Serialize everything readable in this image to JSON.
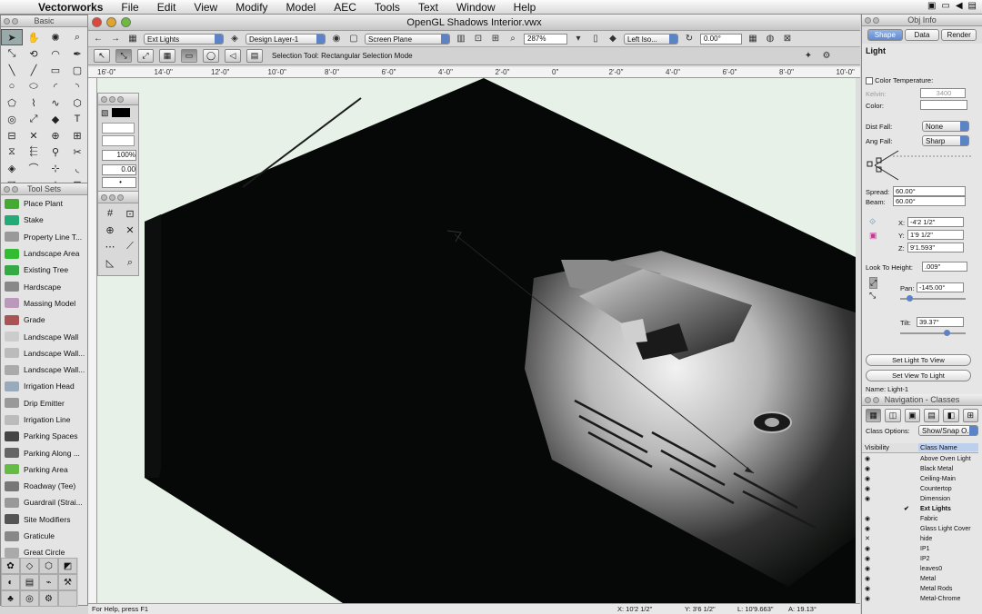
{
  "menubar": {
    "app": "Vectorworks",
    "items": [
      "File",
      "Edit",
      "View",
      "Modify",
      "Model",
      "AEC",
      "Tools",
      "Text",
      "Window",
      "Help"
    ]
  },
  "basic_palette": {
    "title": "Basic",
    "tools": [
      "arrow",
      "pan",
      "flyover",
      "zoom",
      "2d-reshape",
      "rotate",
      "walkthrough",
      "eyedropper",
      "line",
      "text-cursor",
      "rectangle",
      "rounded-rect",
      "circle",
      "oval",
      "arc",
      "quarter-arc",
      "polygon",
      "polyline",
      "freehand",
      "double-line",
      "spiral",
      "regular-polygon",
      "double-polygon",
      "text-T",
      "paragraph",
      "helix",
      "move-camera",
      "section",
      "mirror",
      "offset",
      "wand",
      "clip",
      "symbol",
      "trim",
      "grid-line",
      "fillet",
      "chamfer",
      "connect",
      "split",
      "attribute-map"
    ]
  },
  "toolsets": {
    "title": "Tool Sets",
    "items": [
      "Place Plant",
      "Stake",
      "Property Line T...",
      "Landscape Area",
      "Existing Tree",
      "Hardscape",
      "Massing Model",
      "Grade",
      "Landscape Wall",
      "Landscape Wall...",
      "Landscape Wall...",
      "Irrigation Head",
      "Drip Emitter",
      "Irrigation Line",
      "Parking Spaces",
      "Parking Along ...",
      "Parking Area",
      "Roadway (Tee)",
      "Guardrail (Strai...",
      "Site Modifiers",
      "Graticule",
      "Great Circle"
    ]
  },
  "document": {
    "title": "OpenGL Shadows Interior.vwx",
    "class_popup": "Ext Lights",
    "layer_popup": "Design Layer-1",
    "plane_popup": "Screen Plane",
    "zoom": "287%",
    "view_popup": "Left Iso...",
    "rotation": "0.00°",
    "mode_hint": "Selection Tool: Rectangular Selection Mode"
  },
  "ruler": {
    "labels": [
      "16'-0\"",
      "14'-0\"",
      "12'-0\"",
      "10'-0\"",
      "8'-0\"",
      "6'-0\"",
      "4'-0\"",
      "2'-0\"",
      "0\"",
      "2'-0\"",
      "4'-0\"",
      "6'-0\"",
      "8'-0\"",
      "10'-0\""
    ]
  },
  "attributes": {
    "zoom": "100%",
    "line_weight": "0.00"
  },
  "status": {
    "help": "For Help, press F1",
    "x": "X: 10'2 1/2\"",
    "y": "Y: 3'6 1/2\"",
    "l": "L: 10'9.663\"",
    "a": "A: 19.13°"
  },
  "obj_info": {
    "title": "Obj Info",
    "tabs": [
      "Shape",
      "Data",
      "Render"
    ],
    "object": "Light",
    "color_temp_label": "Color Temperature:",
    "kelvin_label": "Kelvin:",
    "kelvin": "3400",
    "color_label": "Color:",
    "dist_fall_label": "Dist Fall:",
    "dist_fall": "None",
    "ang_fall_label": "Ang Fall:",
    "ang_fall": "Sharp",
    "spread_label": "Spread:",
    "spread": "60.00°",
    "beam_label": "Beam:",
    "beam": "60.00°",
    "x_label": "X:",
    "x": "-4'2 1/2\"",
    "y_label": "Y:",
    "y": "1'9 1/2\"",
    "z_label": "Z:",
    "z": "9'1.593\"",
    "look_label": "Look To Height:",
    "look": ".009\"",
    "pan_label": "Pan:",
    "pan": "-145.00°",
    "tilt_label": "Tilt:",
    "tilt": "39.37°",
    "btn_light_to_view": "Set Light To View",
    "btn_view_to_light": "Set View To Light",
    "name": "Name: Light-1"
  },
  "navigation": {
    "title": "Navigation - Classes",
    "options_label": "Class Options:",
    "options": "Show/Snap O...",
    "col_visibility": "Visibility",
    "col_name": "Class Name",
    "classes": [
      {
        "eye": "◉",
        "name": "Above Oven Light"
      },
      {
        "eye": "◉",
        "name": "Black Metal"
      },
      {
        "eye": "◉",
        "name": "Ceiling-Main"
      },
      {
        "eye": "◉",
        "name": "Countertop"
      },
      {
        "eye": "◉",
        "name": "Dimension"
      },
      {
        "eye": "✔",
        "name": "Ext Lights"
      },
      {
        "eye": "◉",
        "name": "Fabric"
      },
      {
        "eye": "◉",
        "name": "Glass Light Cover"
      },
      {
        "eye": "✕",
        "name": "hide"
      },
      {
        "eye": "◉",
        "name": "IP1"
      },
      {
        "eye": "◉",
        "name": "IP2"
      },
      {
        "eye": "◉",
        "name": "leaves0"
      },
      {
        "eye": "◉",
        "name": "Metal"
      },
      {
        "eye": "◉",
        "name": "Metal Rods"
      },
      {
        "eye": "◉",
        "name": "Metal-Chrome"
      }
    ]
  }
}
